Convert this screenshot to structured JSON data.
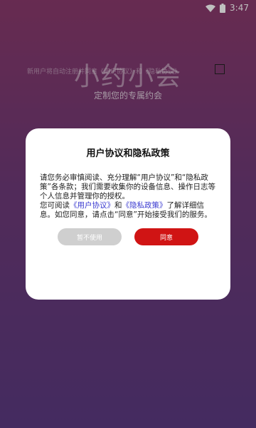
{
  "status_bar": {
    "time": "3:47"
  },
  "background": {
    "app_title": "小约小会",
    "agreement_line": "新用户将自动注册并同意《用户协议》和《隐私协议》",
    "subtitle": "定制您的专属约会"
  },
  "dialog": {
    "title": "用户协议和隐私政策",
    "para1": "请您务必审慎阅读、充分理解“用户协议”和“隐私政策”各条款；我们需要收集你的设备信息、操作日志等个人信息并管理你的授权。",
    "para2_prefix": "您可阅读",
    "user_agreement_link": "《用户协议》",
    "para2_and": "和",
    "privacy_policy_link": "《隐私政策》",
    "para2_suffix": "了解详细信息。如您同意，请点击“同意”开始接受我们的服务。",
    "decline_label": "暂不使用",
    "accept_label": "同意"
  },
  "colors": {
    "accent": "#d01414",
    "decline": "#cfcfcf",
    "link": "#3a3ad0"
  }
}
